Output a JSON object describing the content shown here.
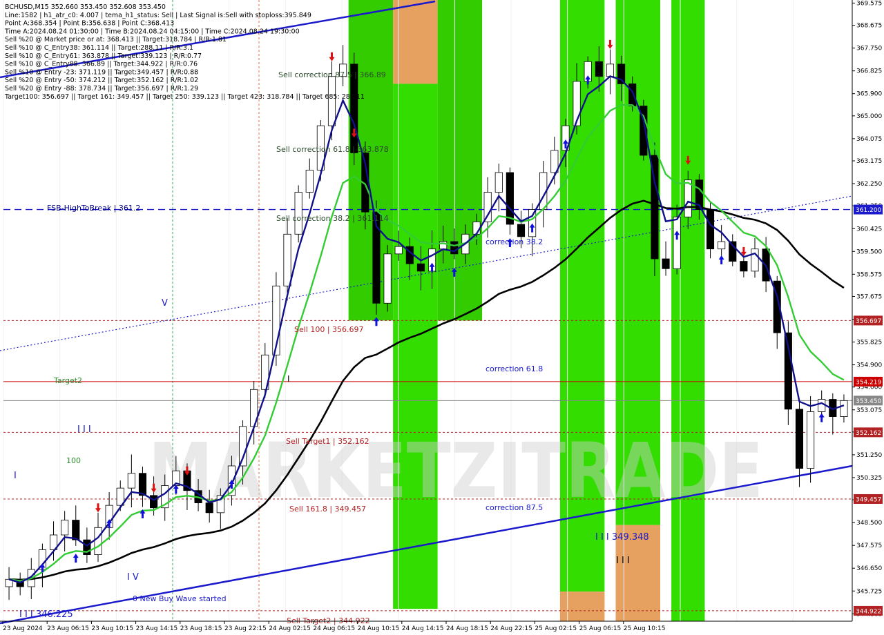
{
  "info": {
    "lines": [
      "BCHUSD,M15  352.660 353.450 352.608 353.450",
      "Line:1582 | h1_atr_c0: 4.007 | tema_h1_status: Sell | Last Signal is:Sell with stoploss:395.849",
      "Point A:368.354 | Point B:356.638 | Point C:368.413",
      "Time A:2024.08.24 01:30:00 | Time B:2024.08.24 04:15:00 | Time C:2024.08.24 19:30:00",
      "Sell %20 @ Market price or at: 368.413 || Target:318.784 | R/R:1.81",
      "Sell %10 @ C_Entry38: 361.114 || Target:288.11 | R/R:3.1",
      "Sell %10 @ C_Entry61: 363.878 || Target:339.123 | R/R:0.77",
      "Sell %10 @ C_Entry88: 366.89 || Target:344.922 | R/R:0.76",
      "Sell %10 @ Entry -23: 371.119 || Target:349.457 | R/R:0.88",
      "Sell %20 @ Entry -50: 374.212 || Target:352.162 | R/R:1.02",
      "Sell %20 @ Entry -88: 378.734 || Target:356.697 | R/R:1.29",
      "Target100: 356.697 || Target 161: 349.457 || Target 250: 339.123 || Target 423: 318.784 || Target 685: 288.11"
    ]
  },
  "watermark": "MARKETZITRADE",
  "annotations": {
    "fsb": "FSB-HighToBreak | 361.2",
    "sell_corr_875": "Sell correction 87.5 | 366.89",
    "sell_corr_618": "Sell correction 61.8 | 363.878",
    "sell_corr_382": "Sell correction 38.2 | 361.114",
    "sell_100": "Sell 100 | 356.697",
    "sell_target1": "Sell Target1 | 352.162",
    "sell_1618": "Sell 161.8 | 349.457",
    "corr_382": "correction 38.2",
    "corr_618": "correction 61.8",
    "corr_875": "correction 87.5",
    "wave_349": "I I I 349.348",
    "wave_346": "I I I 346.225",
    "new_buy": "0 New Buy Wave started",
    "target_tag": "Target2",
    "hundred": "100",
    "iii_left": "I I I",
    "iii_bottom": "I I I",
    "i_mark": "I",
    "iv_mark": "I V",
    "v_mark": "V",
    "bar_mark": "I",
    "bottom_cut": "Sell Target2 | 344.922"
  },
  "chart_data": {
    "type": "candlestick",
    "symbol": "BCHUSD",
    "timeframe": "M15",
    "ohlc_last": {
      "open": 352.66,
      "high": 353.45,
      "low": 352.608,
      "close": 353.45
    },
    "ylim": [
      344.5,
      369.7
    ],
    "y_ticks": [
      369.575,
      368.675,
      367.75,
      366.825,
      365.9,
      365.0,
      364.075,
      363.175,
      362.25,
      361.35,
      360.425,
      359.5,
      358.575,
      357.675,
      356.75,
      355.825,
      354.9,
      354.0,
      353.075,
      352.175,
      351.25,
      350.325,
      349.425,
      348.5,
      347.575,
      346.65,
      345.725,
      344.8
    ],
    "x_ticks": [
      "23 Aug 2024",
      "23 Aug 06:15",
      "23 Aug 10:15",
      "23 Aug 14:15",
      "23 Aug 18:15",
      "23 Aug 22:15",
      "24 Aug 02:15",
      "24 Aug 06:15",
      "24 Aug 10:15",
      "24 Aug 14:15",
      "24 Aug 18:15",
      "24 Aug 22:15",
      "25 Aug 02:15",
      "25 Aug 06:15",
      "25 Aug 10:15"
    ],
    "levels": [
      {
        "name": "FSB-HighToBreak",
        "value": 361.2,
        "label": "361.200",
        "color": "#1a1acc",
        "style": "dashed"
      },
      {
        "name": "Sell 100",
        "value": 356.697,
        "label": "356.697",
        "color": "#b22222",
        "style": "dotted"
      },
      {
        "name": "Red level",
        "value": 354.219,
        "label": "354.219",
        "color": "#cc0000",
        "style": "solid"
      },
      {
        "name": "Current price",
        "value": 353.45,
        "label": "353.450",
        "color": "#888888",
        "style": "solid"
      },
      {
        "name": "Sell Target1",
        "value": 352.162,
        "label": "352.162",
        "color": "#b22222",
        "style": "dotted"
      },
      {
        "name": "Sell 161.8",
        "value": 349.457,
        "label": "349.457",
        "color": "#b22222",
        "style": "dotted"
      },
      {
        "name": "Bottom level",
        "value": 344.922,
        "label": "344.922",
        "color": "#b22222",
        "style": "dotted"
      }
    ],
    "zones": [
      {
        "x_index": [
          31,
          34
        ],
        "top": 369.7,
        "bottom": 356.697,
        "color": "#33cc00"
      },
      {
        "x_index": [
          35,
          38
        ],
        "top": 369.7,
        "bottom": 366.3,
        "color": "#e6a060"
      },
      {
        "x_index": [
          35,
          38
        ],
        "top": 366.3,
        "bottom": 345.0,
        "color": "#33dd00"
      },
      {
        "x_index": [
          39,
          42
        ],
        "top": 369.7,
        "bottom": 356.697,
        "color": "#33cc00"
      },
      {
        "x_index": [
          50,
          53
        ],
        "top": 369.7,
        "bottom": 345.7,
        "color": "#33dd00"
      },
      {
        "x_index": [
          50,
          53
        ],
        "top": 345.7,
        "bottom": 344.5,
        "color": "#e6a060"
      },
      {
        "x_index": [
          55,
          58
        ],
        "top": 369.7,
        "bottom": 348.4,
        "color": "#33dd00"
      },
      {
        "x_index": [
          55,
          58
        ],
        "top": 348.4,
        "bottom": 344.5,
        "color": "#e6a060"
      },
      {
        "x_index": [
          60,
          62
        ],
        "top": 369.7,
        "bottom": 344.5,
        "color": "#33dd00"
      }
    ],
    "closes": [
      346.2,
      345.9,
      346.6,
      347.4,
      348.0,
      348.6,
      347.8,
      347.2,
      348.3,
      349.2,
      349.9,
      350.5,
      349.6,
      349.1,
      350.0,
      350.6,
      349.8,
      349.3,
      348.9,
      349.6,
      350.8,
      352.4,
      353.9,
      355.3,
      358.1,
      360.2,
      361.9,
      362.8,
      364.6,
      366.6,
      367.1,
      363.5,
      361.1,
      357.4,
      359.4,
      359.7,
      359.0,
      358.7,
      359.6,
      359.9,
      359.4,
      360.2,
      360.7,
      361.9,
      362.7,
      360.6,
      360.1,
      361.2,
      362.7,
      363.6,
      364.6,
      366.4,
      367.2,
      366.6,
      367.1,
      366.3,
      365.4,
      363.4,
      359.2,
      358.8,
      360.9,
      362.4,
      361.2,
      359.6,
      359.9,
      359.1,
      358.7,
      359.6,
      358.3,
      356.2,
      353.1,
      350.7,
      353.0,
      353.5,
      352.8,
      353.45
    ],
    "series": [
      {
        "name": "TEMA fast",
        "color": "#10108a"
      },
      {
        "name": "MA medium",
        "color": "#33cc33"
      },
      {
        "name": "MA slow",
        "color": "#000000"
      }
    ]
  }
}
